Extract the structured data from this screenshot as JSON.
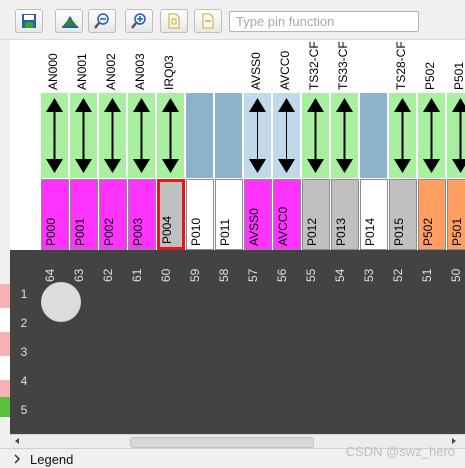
{
  "toolbar": {
    "buttons": [
      {
        "name": "save-icon"
      },
      {
        "name": "chip-view-icon"
      },
      {
        "name": "zoom-out-icon"
      },
      {
        "name": "zoom-in-icon"
      },
      {
        "name": "document-1-icon"
      },
      {
        "name": "document-2-icon"
      }
    ],
    "filter_placeholder": "Type pin function",
    "filter_value": ""
  },
  "colors": {
    "magenta": "#ff33ff",
    "white": "#ffffff",
    "gray": "#c0c0c0",
    "orange": "#ff9e61",
    "arrow_green": "#a8f0a0",
    "arrow_lightblue": "#c2d9ea",
    "blue": "#8db3cc",
    "selected_border": "#e0181b",
    "grid_bg": "#434343"
  },
  "pins": [
    {
      "column": "64",
      "func": "AN000",
      "dir": "bi",
      "pin": "P000",
      "color": "magenta",
      "selected": false
    },
    {
      "column": "63",
      "func": "AN001",
      "dir": "bi",
      "pin": "P001",
      "color": "magenta",
      "selected": false
    },
    {
      "column": "62",
      "func": "AN002",
      "dir": "bi",
      "pin": "P002",
      "color": "magenta",
      "selected": false
    },
    {
      "column": "61",
      "func": "AN003",
      "dir": "bi",
      "pin": "P003",
      "color": "magenta",
      "selected": false
    },
    {
      "column": "60",
      "func": "IRQ03",
      "dir": "bi",
      "pin": "P004",
      "color": "gray",
      "selected": true
    },
    {
      "column": "59",
      "func": "",
      "dir": "none",
      "pin": "P010",
      "color": "white",
      "selected": false
    },
    {
      "column": "58",
      "func": "",
      "dir": "none",
      "pin": "P011",
      "color": "white",
      "selected": false
    },
    {
      "column": "57",
      "func": "AVSS0",
      "dir": "bi-light",
      "pin": "AVSS0",
      "color": "magenta",
      "selected": false
    },
    {
      "column": "56",
      "func": "AVCC0",
      "dir": "bi-light",
      "pin": "AVCC0",
      "color": "magenta",
      "selected": false
    },
    {
      "column": "55",
      "func": "TS32-CF",
      "dir": "bi",
      "pin": "P012",
      "color": "gray",
      "selected": false
    },
    {
      "column": "54",
      "func": "TS33-CF",
      "dir": "bi",
      "pin": "P013",
      "color": "gray",
      "selected": false
    },
    {
      "column": "53",
      "func": "",
      "dir": "none",
      "pin": "P014",
      "color": "white",
      "selected": false
    },
    {
      "column": "52",
      "func": "TS28-CF",
      "dir": "bi",
      "pin": "P015",
      "color": "gray",
      "selected": false
    },
    {
      "column": "51",
      "func": "P502",
      "dir": "bi",
      "pin": "P502",
      "color": "orange",
      "selected": false
    },
    {
      "column": "50",
      "func": "P501",
      "dir": "bi",
      "pin": "P501",
      "color": "orange",
      "selected": false
    }
  ],
  "rows": [
    "1",
    "2",
    "3",
    "4",
    "5"
  ],
  "legend_label": "Legend",
  "watermark": "CSDN @swz_hero"
}
